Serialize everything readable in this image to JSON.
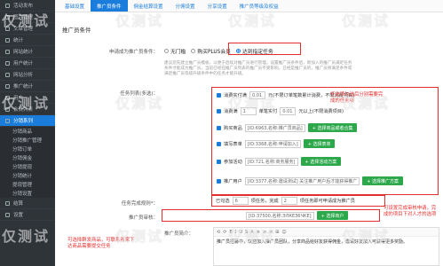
{
  "sidebar": {
    "items": [
      {
        "label": "活动发布",
        "active": false,
        "sub": false
      },
      {
        "label": "图片管理",
        "active": false,
        "sub": false
      },
      {
        "label": "文章管理",
        "active": false,
        "sub": false
      },
      {
        "label": "统计",
        "active": false,
        "sub": false
      },
      {
        "label": "网站统计",
        "active": false,
        "sub": false
      },
      {
        "label": "用户统计",
        "active": false,
        "sub": false
      },
      {
        "label": "网站分析",
        "active": false,
        "sub": false
      },
      {
        "label": "推广统计",
        "active": false,
        "sub": false
      },
      {
        "label": "用户",
        "active": false,
        "sub": false
      },
      {
        "label": "会员列表",
        "active": false,
        "sub": false
      },
      {
        "label": "分销系列",
        "active": true,
        "sub": false
      },
      {
        "label": "分销商品",
        "active": false,
        "sub": true
      },
      {
        "label": "分销推广管理",
        "active": false,
        "sub": true
      },
      {
        "label": "分销订单",
        "active": false,
        "sub": true
      },
      {
        "label": "分销佣金",
        "active": false,
        "sub": true
      },
      {
        "label": "分销提现",
        "active": false,
        "sub": true
      },
      {
        "label": "分销统计",
        "active": false,
        "sub": true
      },
      {
        "label": "提现管理",
        "active": false,
        "sub": true
      },
      {
        "label": "分销设置",
        "active": false,
        "sub": true
      },
      {
        "label": "结算",
        "active": false,
        "sub": false
      },
      {
        "label": "设置",
        "active": false,
        "sub": false
      }
    ]
  },
  "tabs": [
    {
      "label": "基础设置",
      "active": false
    },
    {
      "label": "推广员条件",
      "active": true
    },
    {
      "label": "佣金结算设置",
      "active": false
    },
    {
      "label": "分佣设置",
      "active": false
    },
    {
      "label": "分享设置",
      "active": false
    },
    {
      "label": "推广员等级及权益",
      "active": false
    }
  ],
  "section_title": "推广员条件",
  "condition_label": "申请成为推广员条件：",
  "radios": [
    {
      "label": "无门槛",
      "checked": false
    },
    {
      "label": "购买PLUS会员",
      "checked": false
    },
    {
      "label": "达到指定任务",
      "checked": true
    }
  ],
  "help_lines": [
    "建议您先建立推广员模板，以便于后续对推广员进行管理。设置推广员条件后，新加入的推广员满足任务",
    "条件才能成为推广员，当前已经在推广员列表的推广员不受影响。已经是推广员的，推广员将满足条件或",
    "满足推广员等级升级条件中的任务才能升级。"
  ],
  "task_label": "任务列表(多选)：",
  "tasks": [
    {
      "text": "消费实付满",
      "value": "0.01",
      "suffix": "元(不限订单笔数累计消费，不限消费项目)",
      "button": ""
    },
    {
      "text": "消费满",
      "value": "1",
      "suffix": "单笔实付",
      "value2": "0.01",
      "suffix2": "元以上(不限消费项目)",
      "button": ""
    },
    {
      "text": "购买商品",
      "value": "[ID:6963,名称:推广员商品]",
      "suffix": "",
      "button": "+ 选择商品或者合集"
    },
    {
      "text": "填写表单",
      "value": "[ID:3368,名称:申请加入]",
      "suffix": "",
      "button": "+ 选择表单"
    },
    {
      "text": "参加活动",
      "value": "[ID:721,名称:商务服务]",
      "suffix": "",
      "button": "+ 选择活动方案"
    },
    {
      "text": "推广用户",
      "value": "[ID:3377,名称:邀请测试] 关注推广用户后才能获得推广",
      "suffix": "",
      "button": "+ 选择推广方案"
    }
  ],
  "complete_label": "任务完成规则*：",
  "complete_text1": "已勾选",
  "complete_value1": "6",
  "complete_text2": "项任务，完成",
  "complete_value2": "2",
  "complete_text3": "项任务即可申请成为推广员",
  "approve_label": "推广员审核：",
  "approve_value": "[ID:37500,名称:ЭЛКЕЗ6ЧКЕ]",
  "approve_button": "+ 选择商户",
  "intro_label": "推广员简介：",
  "editor_toolbar": [
    "⟲",
    "⟳",
    "B",
    "I",
    "U",
    "S",
    "A",
    "≡",
    "≡",
    "≡",
    "⊞",
    "☺"
  ],
  "editor_text": "推广员招募中，欢迎加入推广员团队，分享商品给好友获得佣金，邀请好友加入可获得更多奖励。",
  "annotations": {
    "right_top": "任选项勾选后分别需要完成的任务项",
    "right_mid": "可设置完成审核申请，完成的项目下对人才的选项",
    "left_bottom": "可选择群发商品，可联系商家下达商品需要提交任务"
  },
  "watermark": "仅测试"
}
